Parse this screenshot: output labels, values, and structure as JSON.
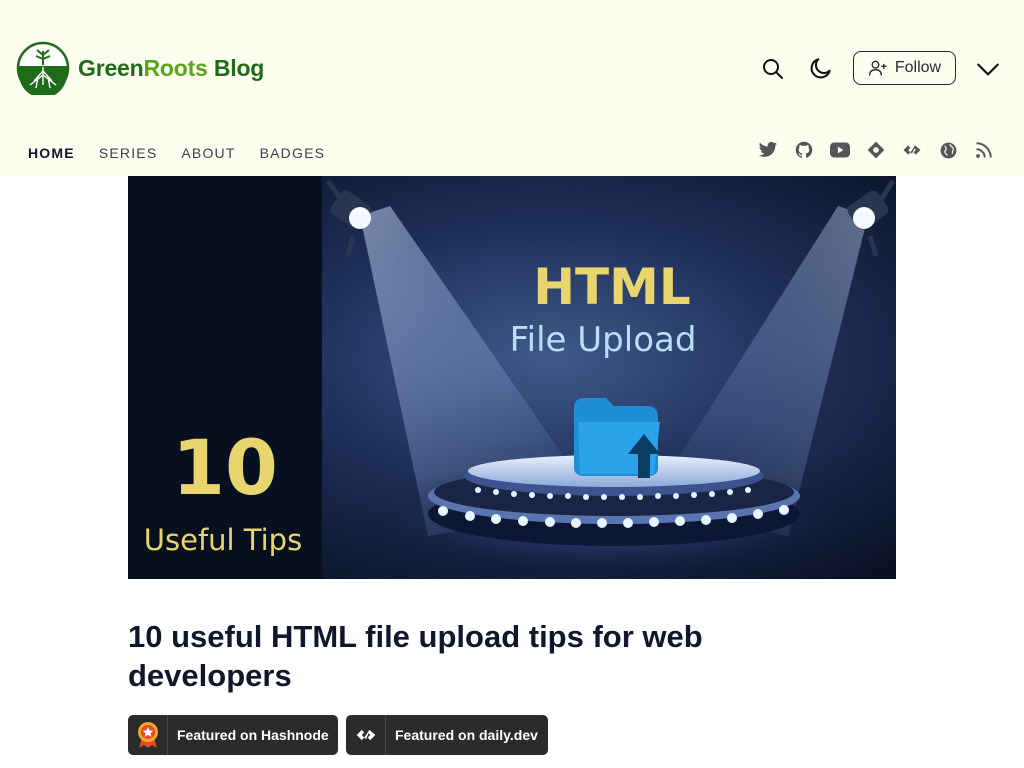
{
  "brand": {
    "name_part1": "Green",
    "name_part2": "Roots",
    "name_part3": " Blog"
  },
  "header": {
    "follow_label": "Follow"
  },
  "nav": [
    {
      "label": "HOME",
      "active": true
    },
    {
      "label": "SERIES",
      "active": false
    },
    {
      "label": "ABOUT",
      "active": false
    },
    {
      "label": "BADGES",
      "active": false
    }
  ],
  "socials": [
    "twitter-icon",
    "github-icon",
    "youtube-icon",
    "hashnode-icon",
    "dailydev-icon",
    "website-icon",
    "rss-icon"
  ],
  "cover": {
    "line1": "HTML",
    "line2": "File Upload",
    "number": "10",
    "tips": "Useful Tips"
  },
  "post": {
    "title": "10 useful HTML file upload tips for web developers"
  },
  "badges": {
    "hashnode": "Featured on Hashnode",
    "dailydev": "Featured on daily.dev"
  },
  "colors": {
    "header_bg": "#fdfeef",
    "brand_dark": "#1e6b1a",
    "brand_light": "#5aa51c",
    "badge_bg": "#2b2b2b"
  }
}
